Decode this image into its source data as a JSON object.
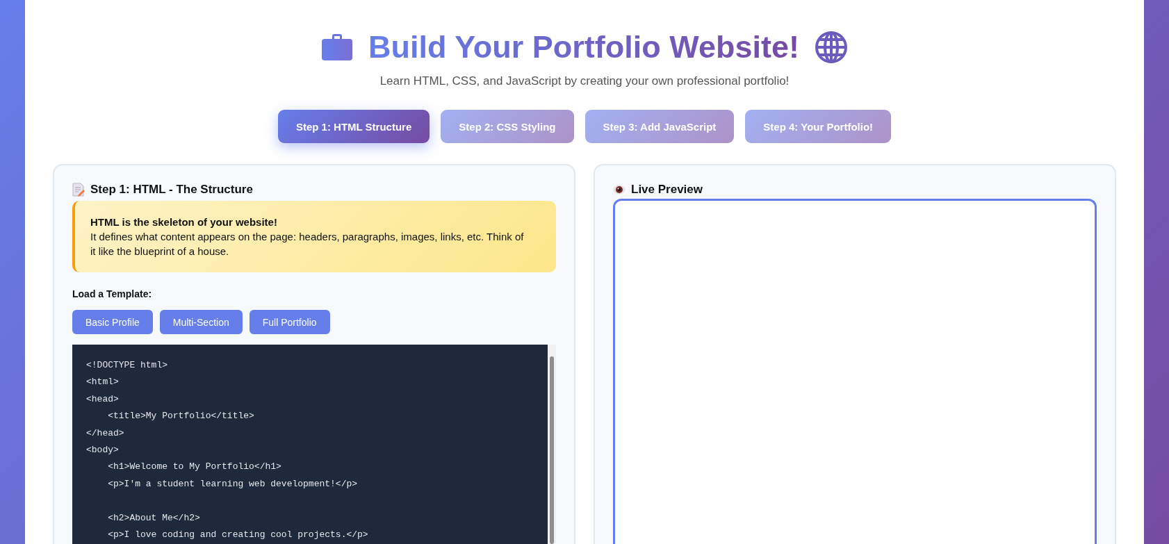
{
  "header": {
    "title": "Build Your Portfolio Website!",
    "subtitle": "Learn HTML, CSS, and JavaScript by creating your own professional portfolio!"
  },
  "tabs": [
    {
      "label": "Step 1: HTML Structure",
      "selected": true
    },
    {
      "label": "Step 2: CSS Styling",
      "selected": false
    },
    {
      "label": "Step 3: Add JavaScript",
      "selected": false
    },
    {
      "label": "Step 4: Your Portfolio!",
      "selected": false
    }
  ],
  "editor_panel": {
    "heading": "Step 1: HTML - The Structure",
    "info": {
      "title": "HTML is the skeleton of your website!",
      "text": "It defines what content appears on the page: headers, paragraphs, images, links, etc. Think of it like the blueprint of a house."
    },
    "template_label": "Load a Template:",
    "templates": [
      "Basic Profile",
      "Multi-Section",
      "Full Portfolio"
    ],
    "code_blocks": [
      [
        "<!DOCTYPE html>",
        "<html>",
        "<head>",
        "    <title>My Portfolio</title>",
        "</head>",
        "<body>",
        "    <h1>Welcome to My Portfolio</h1>",
        "    <p>I'm a student learning web development!</p>"
      ],
      [
        "    <h2>About Me</h2>",
        "    <p>I love coding and creating cool projects.</p>"
      ]
    ]
  },
  "preview_panel": {
    "heading": "Live Preview"
  }
}
